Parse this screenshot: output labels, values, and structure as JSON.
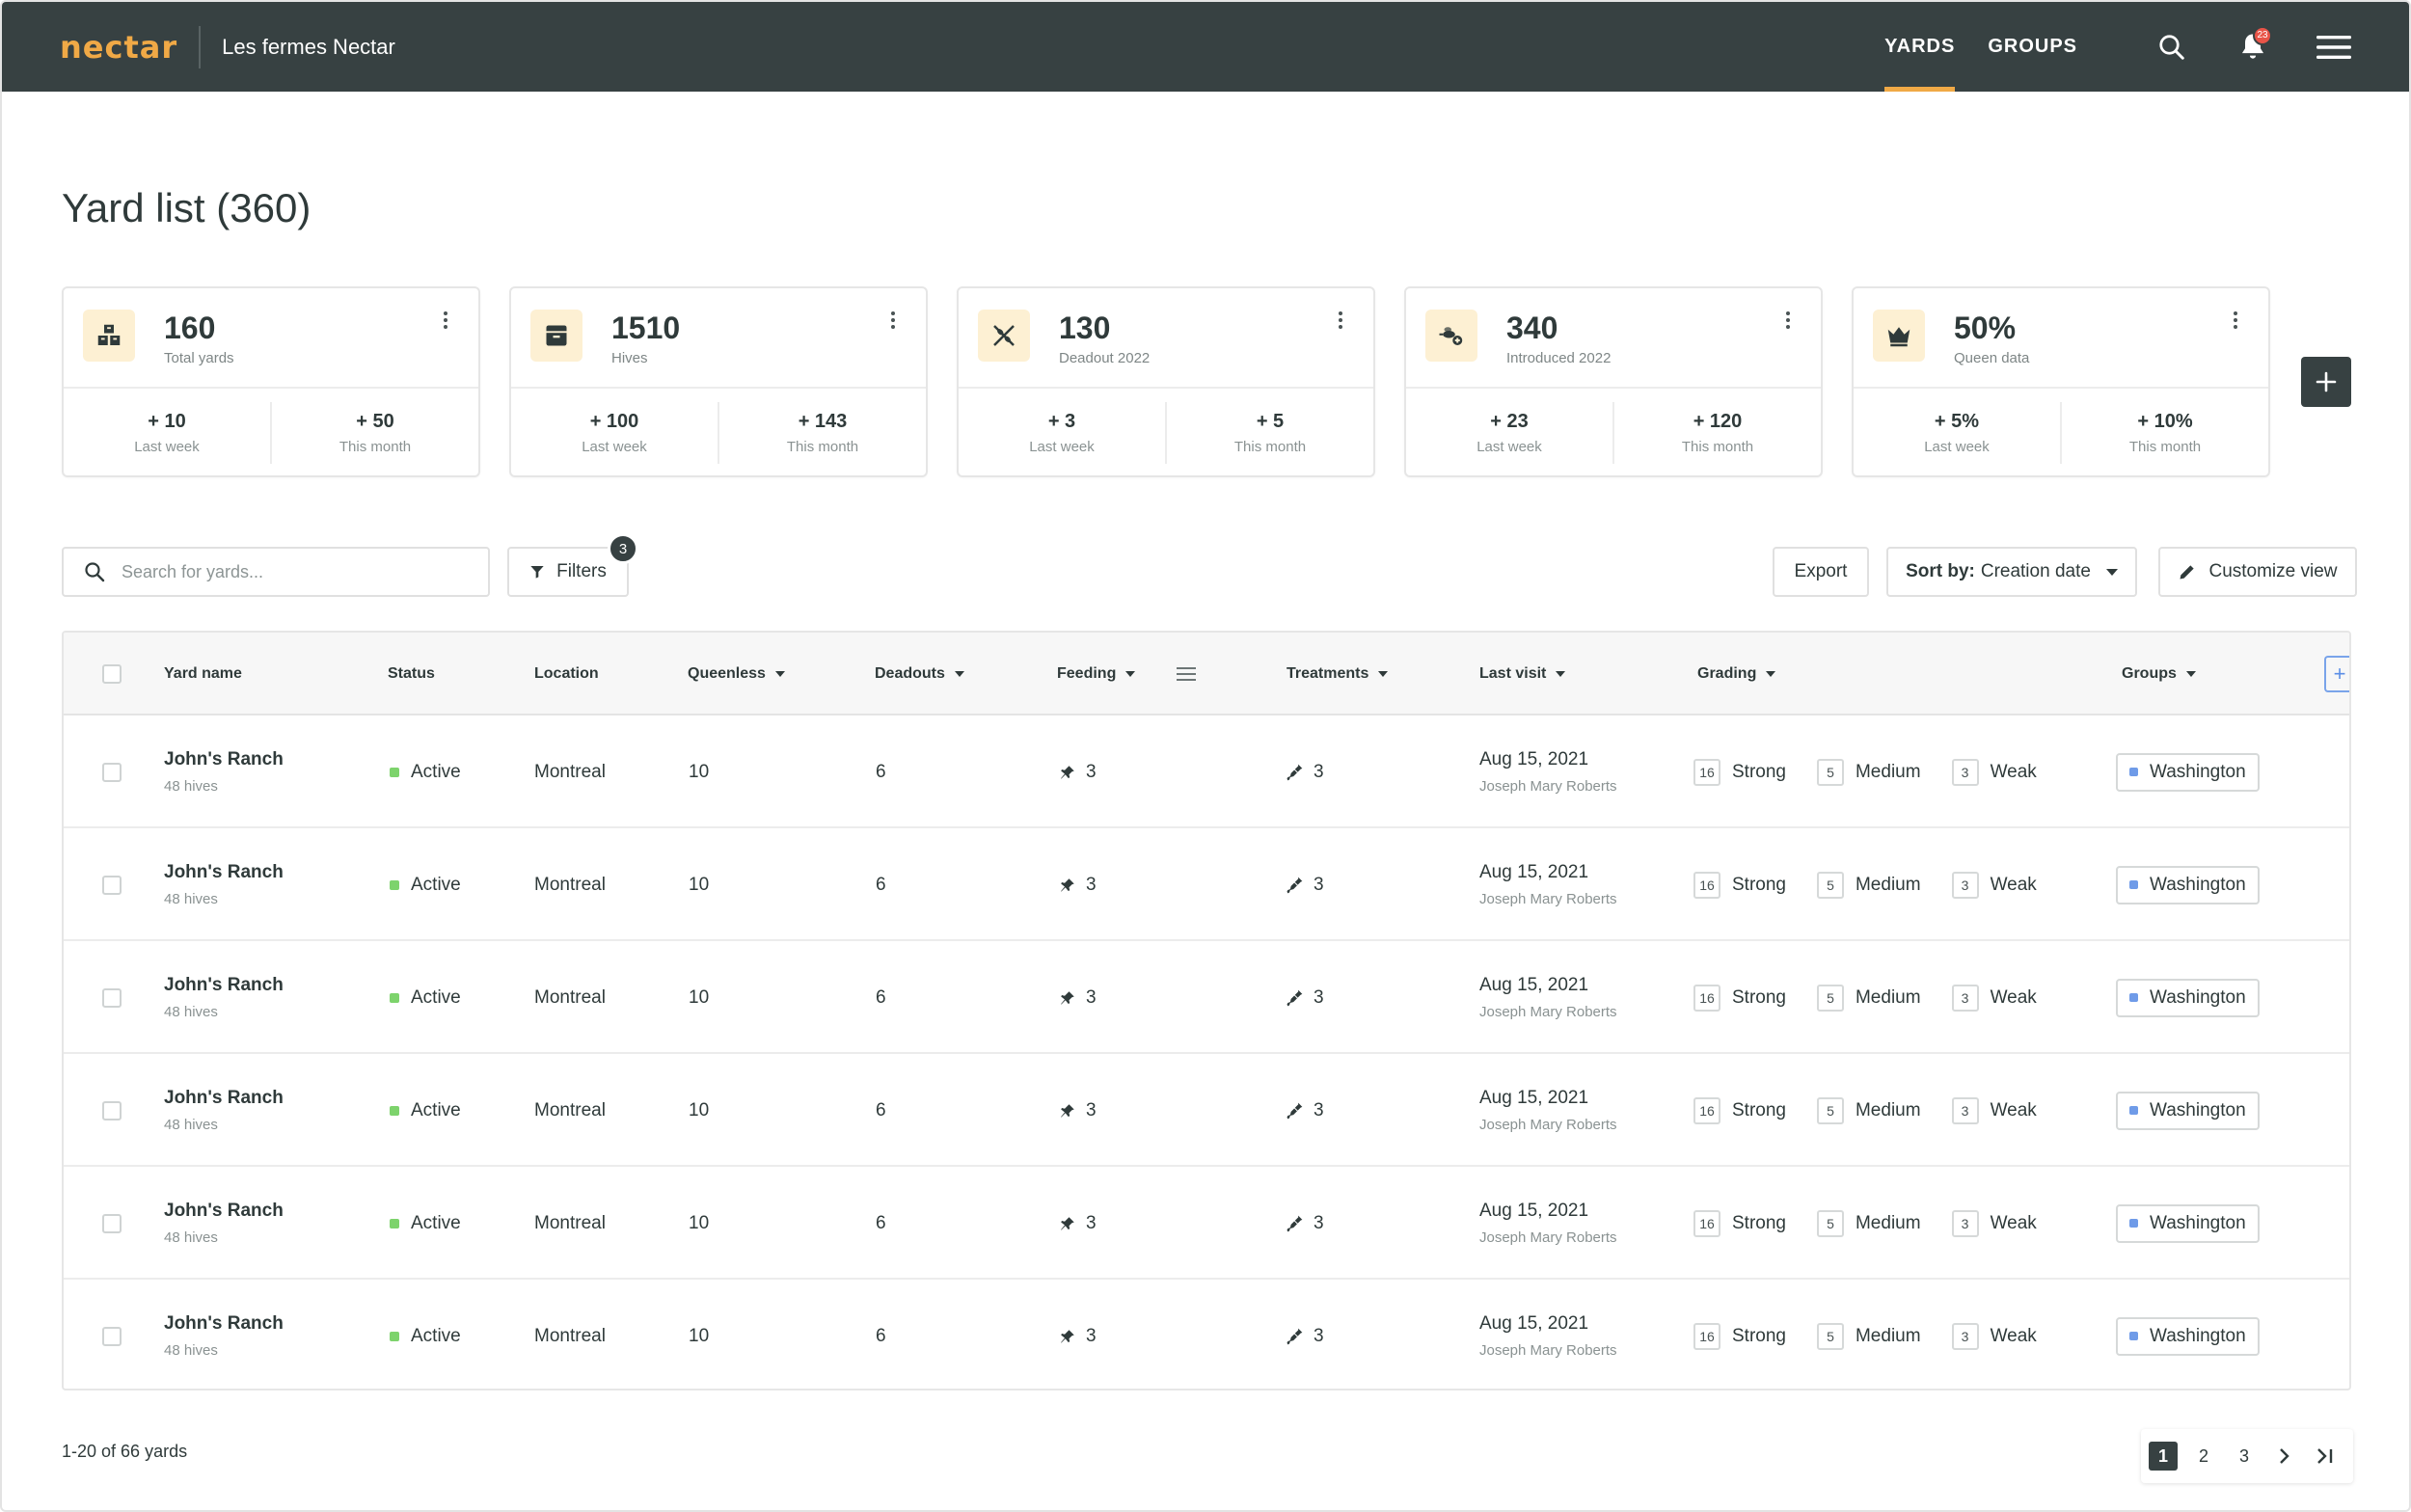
{
  "header": {
    "logo": "nectar",
    "org_name": "Les fermes Nectar",
    "nav": [
      {
        "label": "YARDS",
        "active": true
      },
      {
        "label": "GROUPS",
        "active": false
      }
    ],
    "notification_count": "23",
    "icons": [
      "search-icon",
      "bell-icon",
      "hamburger-menu-icon"
    ]
  },
  "page": {
    "title": "Yard list (360)"
  },
  "stats": [
    {
      "icon": "yards-icon",
      "value": "160",
      "label": "Total yards",
      "sub": [
        {
          "value": "+ 10",
          "label": "Last week"
        },
        {
          "value": "+ 50",
          "label": "This month"
        }
      ]
    },
    {
      "icon": "hive-icon",
      "value": "1510",
      "label": "Hives",
      "sub": [
        {
          "value": "+ 100",
          "label": "Last week"
        },
        {
          "value": "+ 143",
          "label": "This month"
        }
      ]
    },
    {
      "icon": "deadout-icon",
      "value": "130",
      "label": "Deadout 2022",
      "sub": [
        {
          "value": "+ 3",
          "label": "Last week"
        },
        {
          "value": "+ 5",
          "label": "This month"
        }
      ]
    },
    {
      "icon": "introduced-icon",
      "value": "340",
      "label": "Introduced 2022",
      "sub": [
        {
          "value": "+ 23",
          "label": "Last week"
        },
        {
          "value": "+ 120",
          "label": "This month"
        }
      ]
    },
    {
      "icon": "crown-icon",
      "value": "50%",
      "label": "Queen data",
      "sub": [
        {
          "value": "+ 5%",
          "label": "Last week"
        },
        {
          "value": "+ 10%",
          "label": "This month"
        }
      ]
    }
  ],
  "toolbar": {
    "search_placeholder": "Search for yards...",
    "filters_label": "Filters",
    "filters_count": "3",
    "export_label": "Export",
    "sort_prefix": "Sort by:",
    "sort_value": "Creation date",
    "customize_label": "Customize view"
  },
  "table": {
    "columns": {
      "yard_name": "Yard name",
      "status": "Status",
      "location": "Location",
      "queenless": "Queenless",
      "deadouts": "Deadouts",
      "feeding": "Feeding",
      "treatments": "Treatments",
      "last_visit": "Last visit",
      "grading": "Grading",
      "groups": "Groups"
    },
    "add_column": "+",
    "rows": [
      {
        "name": "John's Ranch",
        "hives": "48 hives",
        "status": "Active",
        "location": "Montreal",
        "queenless": "10",
        "deadouts": "6",
        "feeding": "3",
        "treatments": "3",
        "visit_date": "Aug 15, 2021",
        "visit_by": "Joseph Mary Roberts",
        "strong_n": "16",
        "strong": "Strong",
        "medium_n": "5",
        "medium": "Medium",
        "weak_n": "3",
        "weak": "Weak",
        "group": "Washington"
      },
      {
        "name": "John's Ranch",
        "hives": "48 hives",
        "status": "Active",
        "location": "Montreal",
        "queenless": "10",
        "deadouts": "6",
        "feeding": "3",
        "treatments": "3",
        "visit_date": "Aug 15, 2021",
        "visit_by": "Joseph Mary Roberts",
        "strong_n": "16",
        "strong": "Strong",
        "medium_n": "5",
        "medium": "Medium",
        "weak_n": "3",
        "weak": "Weak",
        "group": "Washington"
      },
      {
        "name": "John's Ranch",
        "hives": "48 hives",
        "status": "Active",
        "location": "Montreal",
        "queenless": "10",
        "deadouts": "6",
        "feeding": "3",
        "treatments": "3",
        "visit_date": "Aug 15, 2021",
        "visit_by": "Joseph Mary Roberts",
        "strong_n": "16",
        "strong": "Strong",
        "medium_n": "5",
        "medium": "Medium",
        "weak_n": "3",
        "weak": "Weak",
        "group": "Washington"
      },
      {
        "name": "John's Ranch",
        "hives": "48 hives",
        "status": "Active",
        "location": "Montreal",
        "queenless": "10",
        "deadouts": "6",
        "feeding": "3",
        "treatments": "3",
        "visit_date": "Aug 15, 2021",
        "visit_by": "Joseph Mary Roberts",
        "strong_n": "16",
        "strong": "Strong",
        "medium_n": "5",
        "medium": "Medium",
        "weak_n": "3",
        "weak": "Weak",
        "group": "Washington"
      },
      {
        "name": "John's Ranch",
        "hives": "48 hives",
        "status": "Active",
        "location": "Montreal",
        "queenless": "10",
        "deadouts": "6",
        "feeding": "3",
        "treatments": "3",
        "visit_date": "Aug 15, 2021",
        "visit_by": "Joseph Mary Roberts",
        "strong_n": "16",
        "strong": "Strong",
        "medium_n": "5",
        "medium": "Medium",
        "weak_n": "3",
        "weak": "Weak",
        "group": "Washington"
      },
      {
        "name": "John's Ranch",
        "hives": "48 hives",
        "status": "Active",
        "location": "Montreal",
        "queenless": "10",
        "deadouts": "6",
        "feeding": "3",
        "treatments": "3",
        "visit_date": "Aug 15, 2021",
        "visit_by": "Joseph Mary Roberts",
        "strong_n": "16",
        "strong": "Strong",
        "medium_n": "5",
        "medium": "Medium",
        "weak_n": "3",
        "weak": "Weak",
        "group": "Washington"
      }
    ]
  },
  "footer": {
    "count_text": "1-20 of 66 yards",
    "pages": [
      "1",
      "2",
      "3"
    ],
    "active_page": "1"
  },
  "colors": {
    "topbar": "#374142",
    "accent": "#f0a946",
    "status_active": "#7dd36c",
    "group_tag": "#6f9be8",
    "icon_bg": "#fdf0d3"
  }
}
